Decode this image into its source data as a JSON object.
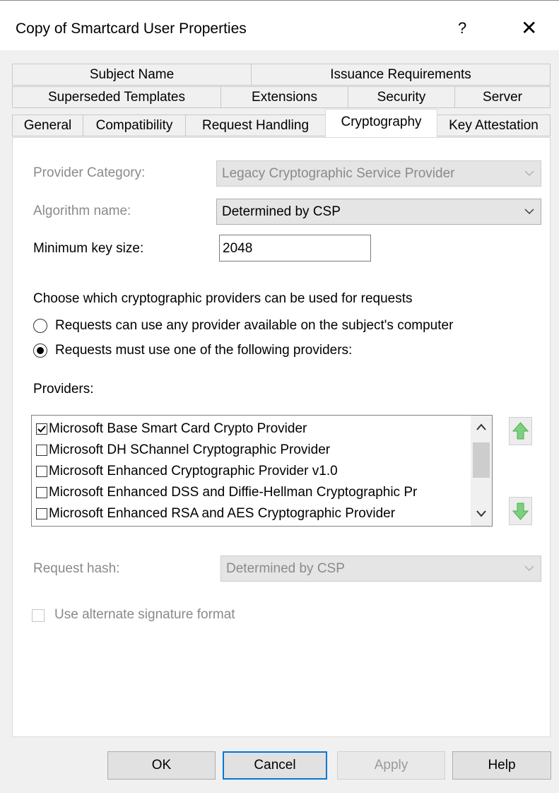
{
  "window": {
    "title": "Copy of Smartcard User Properties",
    "help_glyph": "?",
    "close_glyph": "✕"
  },
  "tabs": {
    "row1": [
      "Subject Name",
      "Issuance Requirements"
    ],
    "row2": [
      "Superseded Templates",
      "Extensions",
      "Security",
      "Server"
    ],
    "row3": [
      "General",
      "Compatibility",
      "Request Handling",
      "Cryptography",
      "Key Attestation"
    ],
    "active": "Cryptography"
  },
  "form": {
    "provider_category": {
      "label": "Provider Category:",
      "value": "Legacy Cryptographic Service Provider",
      "enabled": false
    },
    "algorithm": {
      "label": "Algorithm name:",
      "value": "Determined by CSP",
      "enabled": true
    },
    "min_key_size": {
      "label": "Minimum key size:",
      "value": "2048"
    },
    "choose_heading": "Choose which cryptographic providers can be used for requests",
    "radio_any": {
      "label": "Requests can use any provider available on the subject's computer",
      "checked": false
    },
    "radio_specific": {
      "label": "Requests must use one of the following providers:",
      "checked": true
    },
    "providers_label": "Providers:",
    "providers": [
      {
        "label": "Microsoft Base Smart Card Crypto Provider",
        "checked": true
      },
      {
        "label": "Microsoft DH SChannel Cryptographic Provider",
        "checked": false
      },
      {
        "label": "Microsoft Enhanced Cryptographic Provider v1.0",
        "checked": false
      },
      {
        "label": "Microsoft Enhanced DSS and Diffie-Hellman Cryptographic Pr",
        "checked": false
      },
      {
        "label": "Microsoft Enhanced RSA and AES Cryptographic Provider",
        "checked": false
      }
    ],
    "request_hash": {
      "label": "Request hash:",
      "value": "Determined by CSP",
      "enabled": false
    },
    "alt_signature": {
      "label": "Use alternate signature format",
      "checked": false,
      "enabled": false
    }
  },
  "buttons": {
    "ok": "OK",
    "cancel": "Cancel",
    "apply": "Apply",
    "help": "Help"
  },
  "icons": {
    "move_up": "green-up-arrow-icon",
    "move_down": "green-down-arrow-icon"
  },
  "colors": {
    "focus_border": "#0078d7",
    "arrow_green": "#4cb050",
    "disabled_text": "#8a8a8a"
  }
}
